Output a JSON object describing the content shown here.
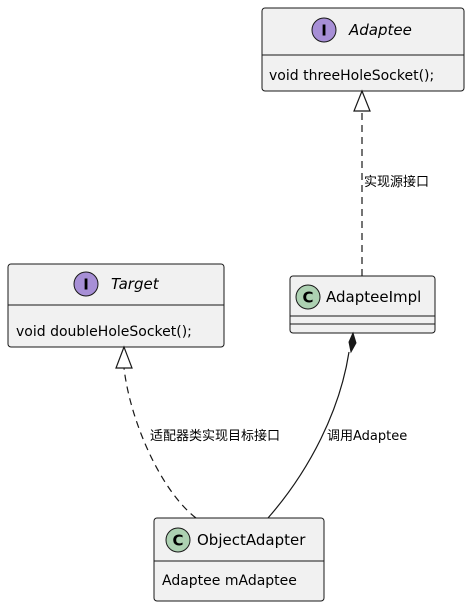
{
  "classes": {
    "adaptee": {
      "stereotype_letter": "I",
      "name": "Adaptee",
      "members": [
        "void threeHoleSocket();"
      ]
    },
    "target": {
      "stereotype_letter": "I",
      "name": "Target",
      "members": [
        "void doubleHoleSocket();"
      ]
    },
    "adaptee_impl": {
      "stereotype_letter": "C",
      "name": "AdapteeImpl",
      "members": []
    },
    "object_adapter": {
      "stereotype_letter": "C",
      "name": "ObjectAdapter",
      "members": [
        "Adaptee mAdaptee"
      ]
    }
  },
  "relations": {
    "impl_to_adaptee": {
      "label": "实现源接口",
      "kind": "realization"
    },
    "adapter_to_target": {
      "label": "适配器类实现目标接口",
      "kind": "realization"
    },
    "adapter_to_impl": {
      "label": "调用Adaptee",
      "kind": "composition"
    }
  },
  "colors": {
    "box_fill": "#f1f1f1",
    "interface_badge": "#a78fd6",
    "class_badge": "#add1b2",
    "line": "#181818"
  }
}
